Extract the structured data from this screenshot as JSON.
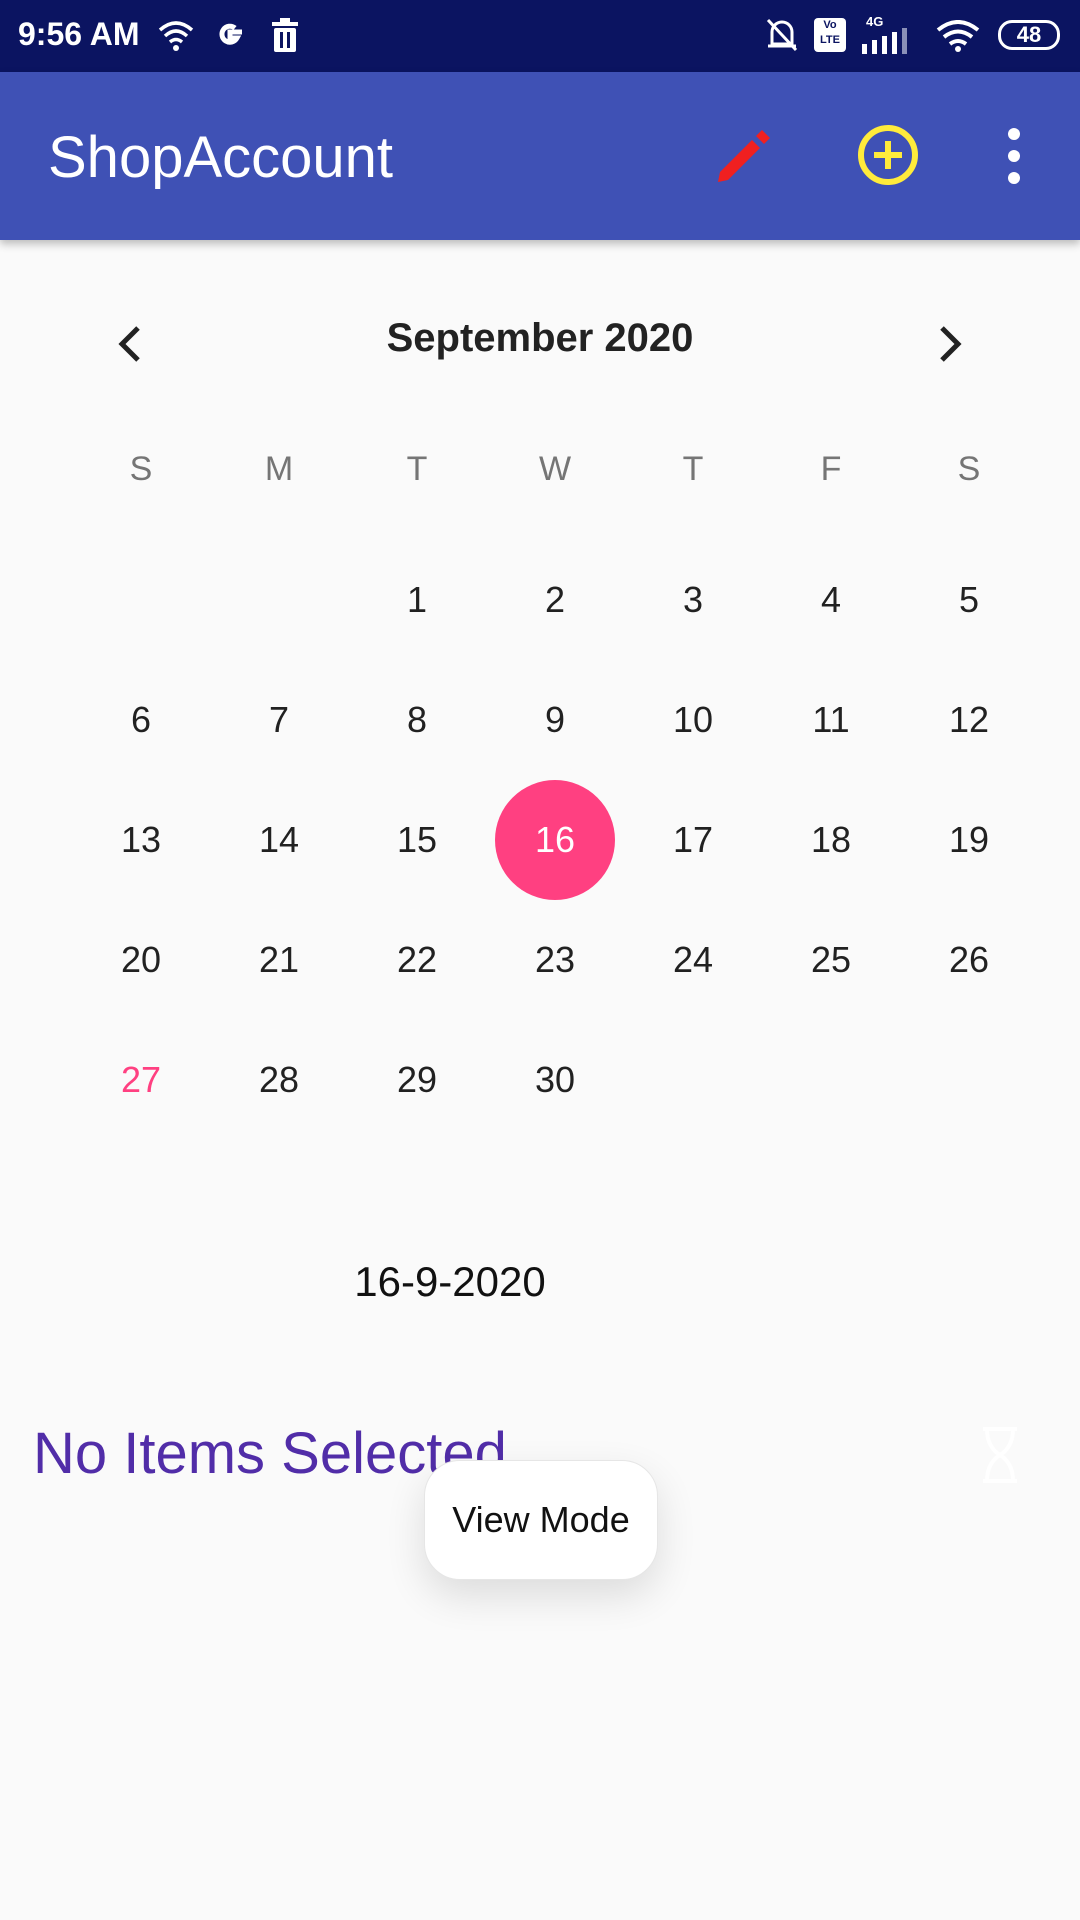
{
  "status_bar": {
    "time": "9:56 AM",
    "battery": "48",
    "network_label": "4G",
    "volte_label": "Vo LTE"
  },
  "app_bar": {
    "title": "ShopAccount",
    "actions": [
      {
        "icon": "pencil-icon",
        "color": "#f02020"
      },
      {
        "icon": "add-circle-icon",
        "color": "#ffeb3b"
      },
      {
        "icon": "more-vert-icon",
        "color": "#ffffff"
      }
    ]
  },
  "calendar": {
    "month_label": "September 2020",
    "weekdays": [
      "S",
      "M",
      "T",
      "W",
      "T",
      "F",
      "S"
    ],
    "weeks": [
      [
        "",
        "",
        "1",
        "2",
        "3",
        "4",
        "5"
      ],
      [
        "6",
        "7",
        "8",
        "9",
        "10",
        "11",
        "12"
      ],
      [
        "13",
        "14",
        "15",
        "16",
        "17",
        "18",
        "19"
      ],
      [
        "20",
        "21",
        "22",
        "23",
        "24",
        "25",
        "26"
      ],
      [
        "27",
        "28",
        "29",
        "30",
        "",
        "",
        ""
      ]
    ],
    "selected_day": "16",
    "today": "27",
    "accent_color": "#ff4081"
  },
  "selected_date_text": "16-9-2020",
  "empty_message": "No Items Selected",
  "toast": "View Mode"
}
